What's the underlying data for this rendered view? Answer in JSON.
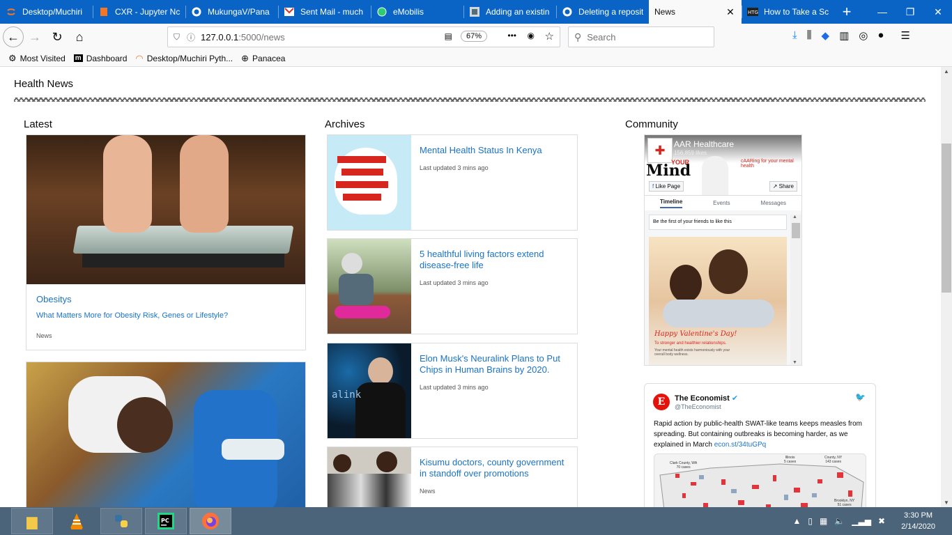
{
  "tabs": [
    {
      "label": "Desktop/Muchiri",
      "icon": "jupyter-icon"
    },
    {
      "label": "CXR - Jupyter Nc",
      "icon": "notebook-icon"
    },
    {
      "label": "MukungaV/Pana",
      "icon": "github-icon"
    },
    {
      "label": "Sent Mail - much",
      "icon": "gmail-icon"
    },
    {
      "label": "eMobilis",
      "icon": "globe-icon"
    },
    {
      "label": "Adding an existin",
      "icon": "page-icon"
    },
    {
      "label": "Deleting a reposit",
      "icon": "github-icon"
    },
    {
      "label": "News",
      "icon": "",
      "active": true
    },
    {
      "label": "How to Take a Sc",
      "icon": "htg-icon"
    }
  ],
  "url": {
    "host": "127.0.0.1",
    "path": ":5000/news",
    "zoom": "67%"
  },
  "search": {
    "placeholder": "Search"
  },
  "bookmarks": [
    "Most Visited",
    "Dashboard",
    "Desktop/Muchiri Pyth...",
    "Panacea"
  ],
  "page": {
    "title": "Health News",
    "latest_heading": "Latest",
    "archives_heading": "Archives",
    "community_heading": "Community",
    "latest": [
      {
        "title": "Obesitys",
        "subtitle": "What Matters More for Obesity Risk, Genes or Lifestyle?",
        "tag": "News"
      }
    ],
    "archives": [
      {
        "title": "Mental Health Status In Kenya",
        "meta": "Last updated 3 mins ago"
      },
      {
        "title": "5 healthful living factors extend disease-free life",
        "meta": "Last updated 3 mins ago"
      },
      {
        "title": "Elon Musk's Neuralink Plans to Put Chips in Human Brains by 2020.",
        "meta": "Last updated 3 mins ago"
      },
      {
        "title": "Kisumu doctors, county government in standoff over promotions",
        "meta": "News"
      }
    ],
    "fb": {
      "name": "AAR Healthcare",
      "likes": "156,859 likes",
      "like_btn": "Like Page",
      "share_btn": "Share",
      "tabs": [
        "Timeline",
        "Events",
        "Messages"
      ],
      "friends_note": "Be the first of your friends to like this",
      "cover_text": "cAARing for your mental health",
      "mind": "Mind",
      "your": "YOUR",
      "valentine": "Happy Valentine's Day!",
      "val_sub": "To stronger and healthier relationships.",
      "val_body": "Your mental health exists harmoniously with your overall body wellness."
    },
    "tweet": {
      "name": "The Economist",
      "handle": "@TheEconomist",
      "text": "Rapid action by public-health SWAT-like teams keeps measles from spreading. But containing outbreaks is becoming harder, as we explained in March",
      "link": "econ.st/34tuGPq",
      "map_labels": [
        "Illinois",
        "5 cases",
        "County, NY",
        "143 cases",
        "Clark County, WA",
        "70 cases",
        "Brooklyn, NY",
        "51 cases"
      ]
    }
  },
  "clock": {
    "time": "3:30 PM",
    "date": "2/14/2020"
  }
}
